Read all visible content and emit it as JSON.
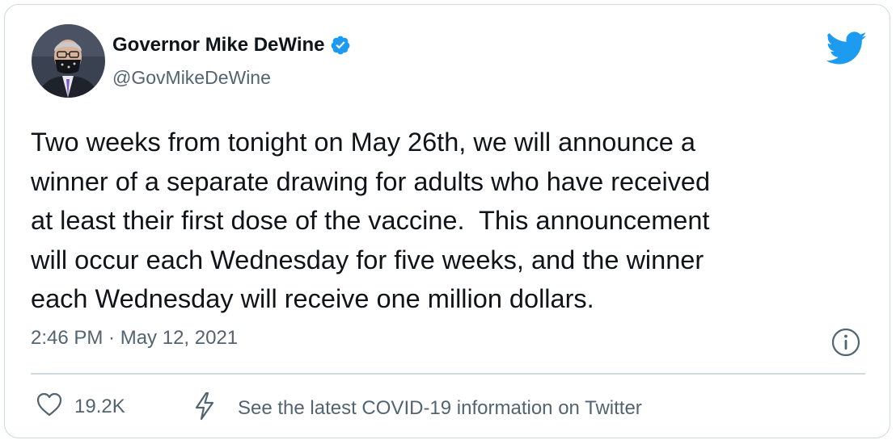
{
  "author": {
    "display_name": "Governor Mike DeWine",
    "handle": "@GovMikeDeWine",
    "verified": true,
    "avatar_icon": "profile-photo"
  },
  "tweet": {
    "text": "Two weeks from tonight on May 26th, we will announce a\nwinner of a separate drawing for adults who have received\nat least their first dose of the vaccine.  This announcement\nwill occur each Wednesday for five weeks, and the winner\neach Wednesday will receive one million dollars.",
    "timestamp": "2:46 PM · May 12, 2021"
  },
  "footer": {
    "like_count": "19.2K",
    "covid_link": "See the latest COVID-19 information on Twitter"
  },
  "icons": {
    "brand": "twitter-bird-icon",
    "info": "info-icon",
    "like": "heart-icon",
    "covid": "lightning-icon"
  },
  "colors": {
    "brand": "#1d9bf0",
    "text": "#0f1419",
    "secondary": "#536471",
    "border": "#cfd9de"
  }
}
